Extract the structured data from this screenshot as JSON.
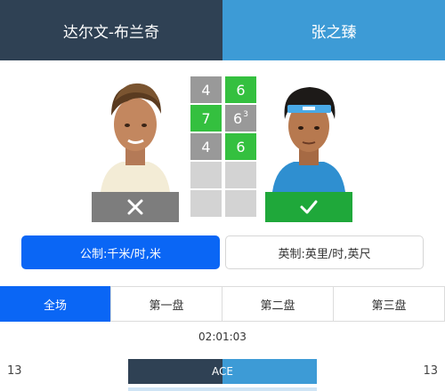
{
  "players": {
    "left": {
      "name": "达尔文-布兰奇",
      "result": "lose",
      "result_icon": "x-icon",
      "color": "#2f4154"
    },
    "right": {
      "name": "张之臻",
      "result": "win",
      "result_icon": "check-icon",
      "color": "#3d9bd6"
    }
  },
  "sets": [
    {
      "left": "4",
      "right": "6",
      "winner": "right"
    },
    {
      "left": "7",
      "right": "6",
      "right_tiebreak": "3",
      "winner": "left"
    },
    {
      "left": "4",
      "right": "6",
      "winner": "right"
    },
    {
      "left": "",
      "right": "",
      "winner": ""
    },
    {
      "left": "",
      "right": "",
      "winner": ""
    }
  ],
  "units": {
    "metric": "公制:千米/时,米",
    "imperial": "英制:英里/时,英尺",
    "selected": "metric"
  },
  "tabs": {
    "items": [
      "全场",
      "第一盘",
      "第二盘",
      "第三盘"
    ],
    "selected": 0
  },
  "duration": "02:01:03",
  "stat": {
    "label": "ACE",
    "left_value": "13",
    "right_value": "13",
    "left_share": 0.5
  },
  "colors": {
    "accent": "#0a66f5",
    "win": "#34c03f",
    "lose_cell": "#999999"
  }
}
